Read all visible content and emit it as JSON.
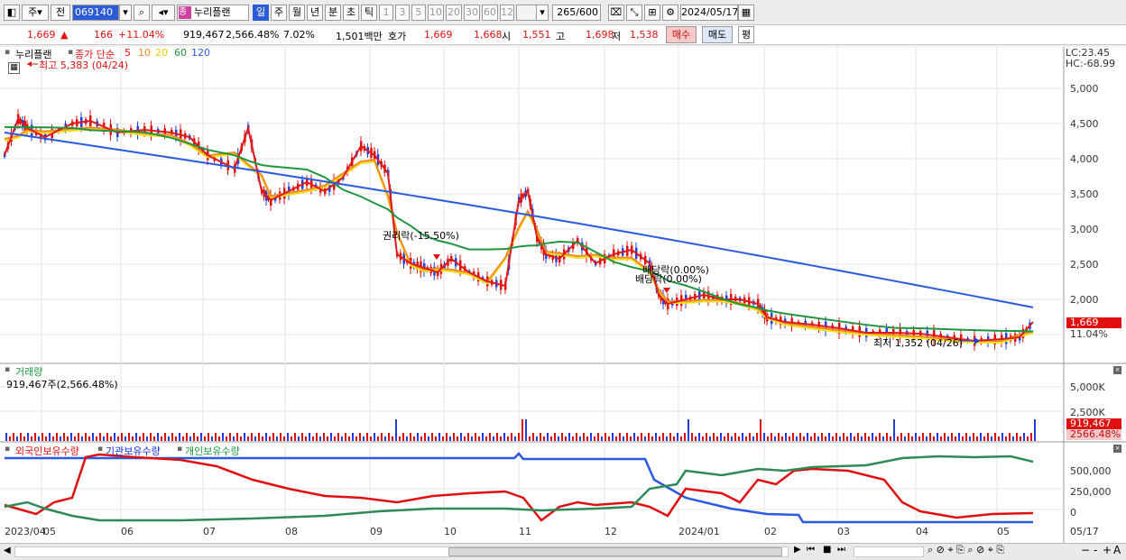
{
  "toolbar": {
    "cycle_items": [
      "주",
      "전"
    ],
    "code": "069140",
    "stock_name": "누리플랜",
    "stock_badge": "종",
    "periods": [
      "일",
      "주",
      "월",
      "년",
      "분",
      "초",
      "틱"
    ],
    "intervals": [
      "1",
      "3",
      "5",
      "10",
      "20",
      "30",
      "60",
      "120"
    ],
    "count": "265",
    "count_total": "/600",
    "date": "2024/05/17"
  },
  "quote": {
    "price": "1,669",
    "arrow": "▲",
    "change": "166",
    "change_pct": "+11.04%",
    "volume": "919,467",
    "volume_pct": "2,566.48%",
    "turnover_pct": "7.02%",
    "amount": "1,501백만",
    "ask_label": "호가",
    "ask": "1,669",
    "bid": "1,668",
    "open_label": "시",
    "open": "1,551",
    "high_label": "고",
    "high": "1,698",
    "low_label": "저",
    "low": "1,538",
    "buy_label": "매수",
    "sell_label": "매도",
    "eval_label": "평"
  },
  "price_panel": {
    "legend_name": "누리플랜",
    "legend_ma": "종가 단순",
    "ma_periods": [
      "5",
      "10",
      "20",
      "60",
      "120"
    ],
    "high_note": "최고 5,383 (04/24)",
    "low_note": "최저 1,352 (04/26)",
    "rights_note": "권리락(-15.50%)",
    "div_note1": "배당락(0.00%)",
    "div_note2": "배당락(0.00%)",
    "lc": "LC:23.45",
    "hc": "HC:-68.99",
    "last_price": "1,669",
    "last_pct": "11.04%",
    "y_ticks": [
      "5,000",
      "4,500",
      "4,000",
      "3,500",
      "3,000",
      "2,500",
      "2,000"
    ]
  },
  "volume_panel": {
    "title": "거래량",
    "value": "919,467주(2,566.48%)",
    "y_ticks": [
      "5,000K",
      "2,500K"
    ],
    "last_volume": "919,467",
    "last_pct": "2566.48%"
  },
  "holdings_panel": {
    "legend": [
      "외국인보유수량",
      "기관보유수량",
      "개인보유수량"
    ],
    "y_ticks": [
      "500,000",
      "250,000",
      "0"
    ]
  },
  "x_axis": [
    "2023/04",
    "05",
    "06",
    "07",
    "08",
    "09",
    "10",
    "11",
    "12",
    "2024/01",
    "02",
    "03",
    "04",
    "05",
    "05/17"
  ],
  "colors": {
    "ma5": "#e01a1a",
    "ma10": "#f08c1e",
    "ma20": "#f0e020",
    "ma60": "#1e9640",
    "ma120": "#2a5ae0",
    "foreign": "#e01010",
    "inst": "#2a5ae0",
    "indiv": "#2e8b57"
  }
}
